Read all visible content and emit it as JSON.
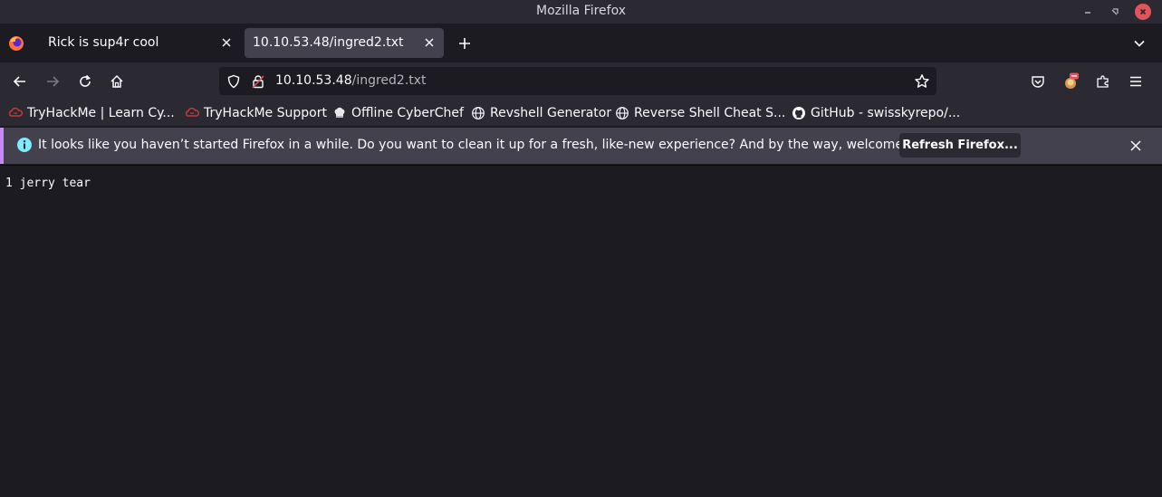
{
  "window": {
    "title": "Mozilla Firefox"
  },
  "tabs": [
    {
      "label": "Rick is sup4r cool"
    },
    {
      "label": "10.10.53.48/ingred2.txt",
      "active": true
    }
  ],
  "urlbar": {
    "host": "10.10.53.48",
    "path": "/ingred2.txt"
  },
  "bookmarks": [
    {
      "label": "TryHackMe | Learn Cy...",
      "icon": "tryhackme-icon"
    },
    {
      "label": "TryHackMe Support",
      "icon": "tryhackme-icon"
    },
    {
      "label": "Offline CyberChef",
      "icon": "chef-hat-icon"
    },
    {
      "label": "Revshell Generator",
      "icon": "globe-icon"
    },
    {
      "label": "Reverse Shell Cheat S...",
      "icon": "globe-icon"
    },
    {
      "label": "GitHub - swisskyrepo/...",
      "icon": "github-icon"
    }
  ],
  "notification": {
    "message": "It looks like you haven’t started Firefox in a while. Do you want to clean it up for a fresh, like-new experience? And by the way, welcome back!",
    "button_label": "Refresh Firefox..."
  },
  "page": {
    "text": "1 jerry tear"
  },
  "colors": {
    "accent": "#c688ff",
    "close_red": "#e2535a",
    "toolbar": "#2b2a33",
    "background": "#1c1b22"
  }
}
